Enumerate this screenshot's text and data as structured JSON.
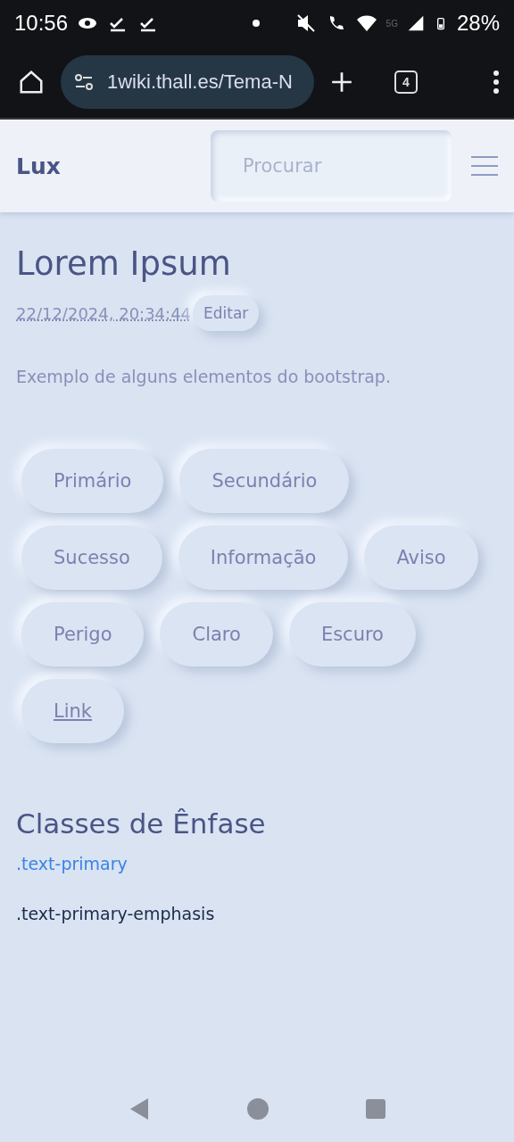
{
  "status_bar": {
    "time": "10:56",
    "network": "5G",
    "battery": "28%"
  },
  "browser": {
    "url": "1wiki.thall.es/Tema-N",
    "tab_count": "4"
  },
  "navbar": {
    "brand": "Lux",
    "search": {
      "placeholder": "Procurar"
    }
  },
  "page": {
    "title": "Lorem Ipsum",
    "timestamp": "22/12/2024, 20:34:44",
    "edit_button": "Editar",
    "intro": "Exemplo de alguns elementos do bootstrap.",
    "buttons": [
      {
        "label": "Primário",
        "kind": "button"
      },
      {
        "label": "Secundário",
        "kind": "button"
      },
      {
        "label": "Sucesso",
        "kind": "button"
      },
      {
        "label": "Informação",
        "kind": "button"
      },
      {
        "label": "Aviso",
        "kind": "button"
      },
      {
        "label": "Perigo",
        "kind": "button"
      },
      {
        "label": "Claro",
        "kind": "button"
      },
      {
        "label": "Escuro",
        "kind": "button"
      },
      {
        "label": "Link",
        "kind": "link"
      }
    ],
    "section_title": "Classes de Ênfase",
    "emphasis": [
      {
        "text": ".text-primary",
        "color": "#3b82e6"
      },
      {
        "text": ".text-primary-emphasis",
        "color": "#1a2a4a"
      }
    ]
  }
}
